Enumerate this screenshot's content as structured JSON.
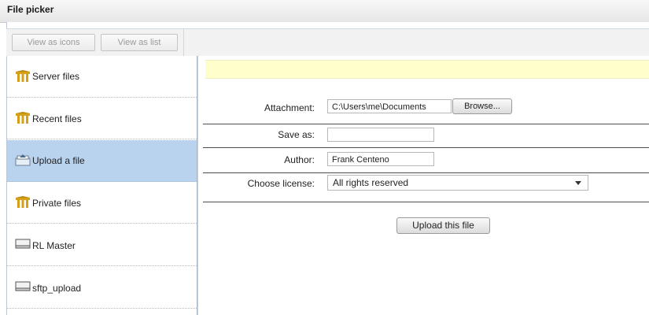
{
  "window": {
    "title": "File picker"
  },
  "toolbar": {
    "view_icons": "View as icons",
    "view_list": "View as list"
  },
  "sidebar": {
    "items": [
      {
        "label": "Server files",
        "icon": "repository-icon",
        "active": false
      },
      {
        "label": "Recent files",
        "icon": "repository-icon",
        "active": false
      },
      {
        "label": "Upload a file",
        "icon": "upload-icon",
        "active": true
      },
      {
        "label": "Private files",
        "icon": "repository-icon",
        "active": false
      },
      {
        "label": "RL Master",
        "icon": "drive-icon",
        "active": false
      },
      {
        "label": "sftp_upload",
        "icon": "drive-icon",
        "active": false
      }
    ]
  },
  "form": {
    "attachment_label": "Attachment:",
    "attachment_value": "C:\\Users\\me\\Documents",
    "browse_label": "Browse...",
    "saveas_label": "Save as:",
    "saveas_value": "",
    "author_label": "Author:",
    "author_value": "Frank Centeno",
    "license_label": "Choose license:",
    "license_value": "All rights reserved",
    "upload_label": "Upload this file"
  },
  "colors": {
    "active_item": "#b9d3ee",
    "notice": "#ffffcc",
    "repo_icon": "#d4a017"
  }
}
